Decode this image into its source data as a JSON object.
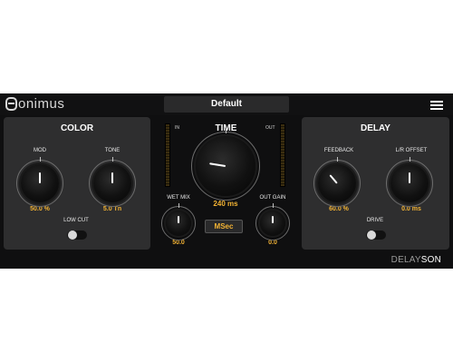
{
  "header": {
    "brand": "onimus",
    "preset": "Default",
    "menu_icon": "hamburger-menu-icon"
  },
  "color": {
    "title": "COLOR",
    "mod": {
      "label": "MOD",
      "value": "50.0 %",
      "level": 0.5
    },
    "tone": {
      "label": "TONE",
      "value": "5.0 Tn",
      "level": 0.5
    },
    "low_cut": {
      "label": "LOW CUT",
      "on": false
    }
  },
  "time": {
    "title": "TIME",
    "in_label": "IN",
    "out_label": "OUT",
    "value": "240 ms",
    "level": 0.2,
    "mode": "MSec",
    "wet_mix": {
      "label": "WET MIX",
      "value": "50.0",
      "level": 0.5
    },
    "out_gain": {
      "label": "OUT GAIN",
      "value": "0.0",
      "level": 0.5
    }
  },
  "delay": {
    "title": "DELAY",
    "feedback": {
      "label": "FEEDBACK",
      "value": "60.0 %",
      "level": 0.35
    },
    "lr_offset": {
      "label": "L/R OFFSET",
      "value": "0.0 ms",
      "level": 0.5
    },
    "drive": {
      "label": "DRIVE",
      "on": false
    }
  },
  "footer": {
    "brand_prefix": "DELAY",
    "brand_suffix": "SON"
  },
  "colors": {
    "accent": "#f2b233",
    "panel": "#2e2e2f",
    "background": "#0f0f10"
  }
}
